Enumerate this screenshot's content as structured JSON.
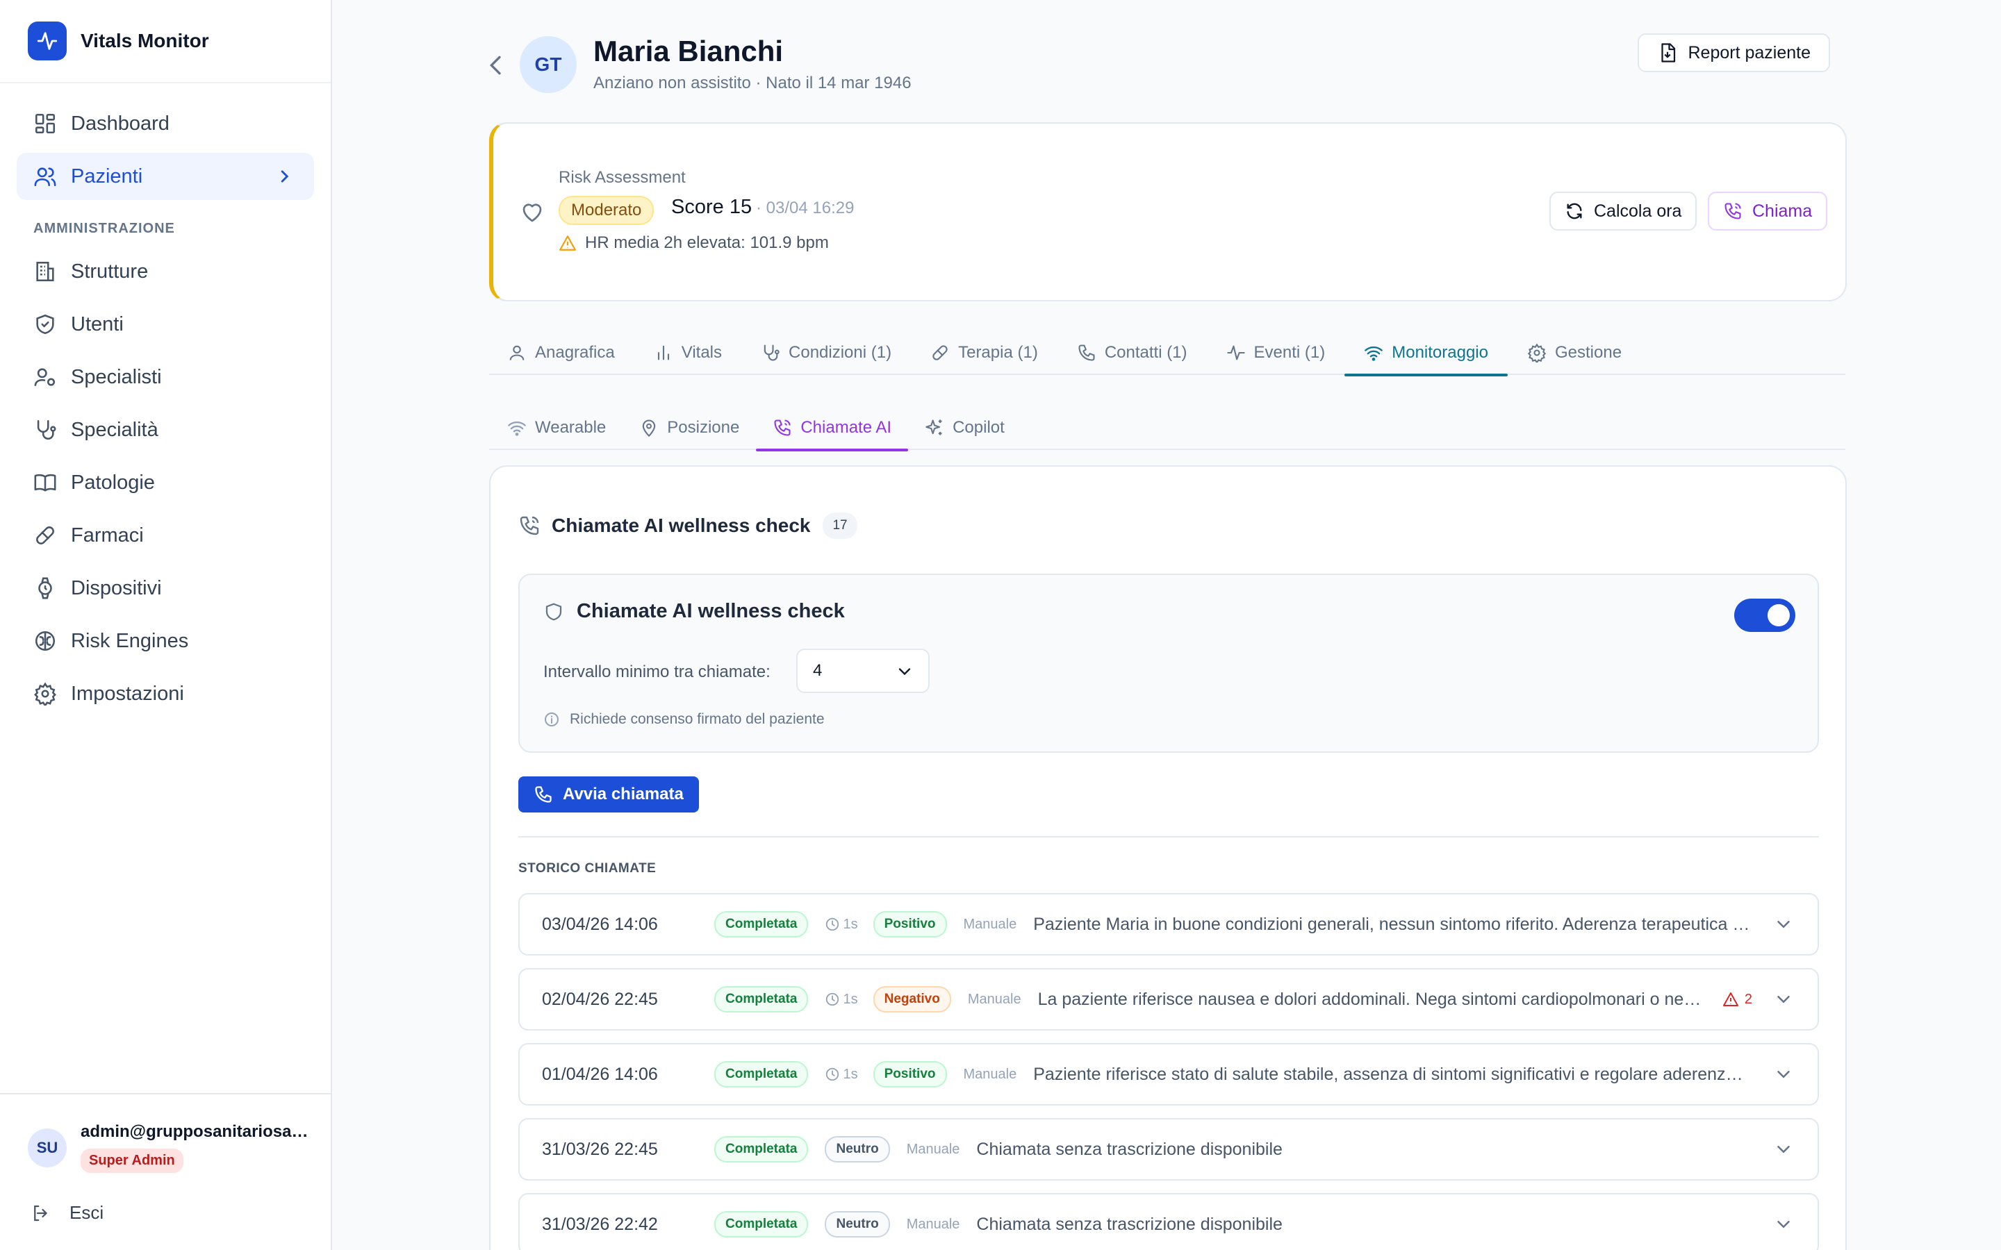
{
  "app": {
    "name": "Vitals Monitor"
  },
  "sidebar": {
    "items": [
      {
        "label": "Dashboard",
        "icon": "dashboard-icon"
      },
      {
        "label": "Pazienti",
        "icon": "users-icon",
        "active": true
      }
    ],
    "section_title": "AMMINISTRAZIONE",
    "admin_items": [
      {
        "label": "Strutture",
        "icon": "building-icon"
      },
      {
        "label": "Utenti",
        "icon": "shield-icon"
      },
      {
        "label": "Specialisti",
        "icon": "user-cog-icon"
      },
      {
        "label": "Specialità",
        "icon": "stethoscope-icon"
      },
      {
        "label": "Patologie",
        "icon": "book-icon"
      },
      {
        "label": "Farmaci",
        "icon": "pill-icon"
      },
      {
        "label": "Dispositivi",
        "icon": "watch-icon"
      },
      {
        "label": "Risk Engines",
        "icon": "brain-icon"
      },
      {
        "label": "Impostazioni",
        "icon": "gear-icon"
      }
    ],
    "user": {
      "initials": "SU",
      "email": "admin@grupposanitariosal...",
      "role": "Super Admin"
    },
    "logout_label": "Esci"
  },
  "patient": {
    "initials": "GT",
    "name": "Maria Bianchi",
    "subtitle": "Anziano non assistito · Nato il 14 mar 1946",
    "report_label": "Report paziente"
  },
  "risk": {
    "title": "Risk Assessment",
    "level": "Moderato",
    "score": "Score 15",
    "time": "· 03/04 16:29",
    "alert": "HR media 2h elevata: 101.9 bpm",
    "calc_label": "Calcola ora",
    "call_label": "Chiama",
    "accent_color": "#eab308"
  },
  "tabs": [
    {
      "label": "Anagrafica",
      "icon": "user-icon"
    },
    {
      "label": "Vitals",
      "icon": "bar-chart-icon"
    },
    {
      "label": "Condizioni (1)",
      "icon": "stethoscope-icon"
    },
    {
      "label": "Terapia (1)",
      "icon": "pill-icon"
    },
    {
      "label": "Contatti (1)",
      "icon": "phone-icon"
    },
    {
      "label": "Eventi (1)",
      "icon": "activity-icon"
    },
    {
      "label": "Monitoraggio",
      "icon": "wifi-icon",
      "active": true
    },
    {
      "label": "Gestione",
      "icon": "gear-icon"
    }
  ],
  "subtabs": [
    {
      "label": "Wearable",
      "icon": "wifi-icon"
    },
    {
      "label": "Posizione",
      "icon": "map-pin-icon"
    },
    {
      "label": "Chiamate AI",
      "icon": "phone-call-icon",
      "active": true
    },
    {
      "label": "Copilot",
      "icon": "sparkles-icon"
    }
  ],
  "panel": {
    "title": "Chiamate AI wellness check",
    "count": "17",
    "settings": {
      "title": "Chiamate AI wellness check",
      "enabled": true,
      "interval_label": "Intervallo minimo tra chiamate:",
      "interval_value": "4",
      "consent_note": "Richiede consenso firmato del paziente"
    },
    "start_label": "Avvia chiamata",
    "history_title": "STORICO CHIAMATE",
    "calls": [
      {
        "date": "03/04/26 14:06",
        "status": "Completata",
        "duration": "1s",
        "sentiment": "Positivo",
        "mode": "Manuale",
        "summary": "Paziente Maria in buone condizioni generali, nessun sintomo riferito. Aderenza terapeutica re...",
        "alerts": ""
      },
      {
        "date": "02/04/26 22:45",
        "status": "Completata",
        "duration": "1s",
        "sentiment": "Negativo",
        "mode": "Manuale",
        "summary": "La paziente riferisce nausea e dolori addominali. Nega sintomi cardiopolmonari o neu...",
        "alerts": "2"
      },
      {
        "date": "01/04/26 14:06",
        "status": "Completata",
        "duration": "1s",
        "sentiment": "Positivo",
        "mode": "Manuale",
        "summary": "Paziente riferisce stato di salute stabile, assenza di sintomi significativi e regolare aderenza ...",
        "alerts": ""
      },
      {
        "date": "31/03/26 22:45",
        "status": "Completata",
        "duration": "",
        "sentiment": "Neutro",
        "mode": "Manuale",
        "summary": "Chiamata senza trascrizione disponibile",
        "alerts": ""
      },
      {
        "date": "31/03/26 22:42",
        "status": "Completata",
        "duration": "",
        "sentiment": "Neutro",
        "mode": "Manuale",
        "summary": "Chiamata senza trascrizione disponibile",
        "alerts": ""
      }
    ]
  }
}
